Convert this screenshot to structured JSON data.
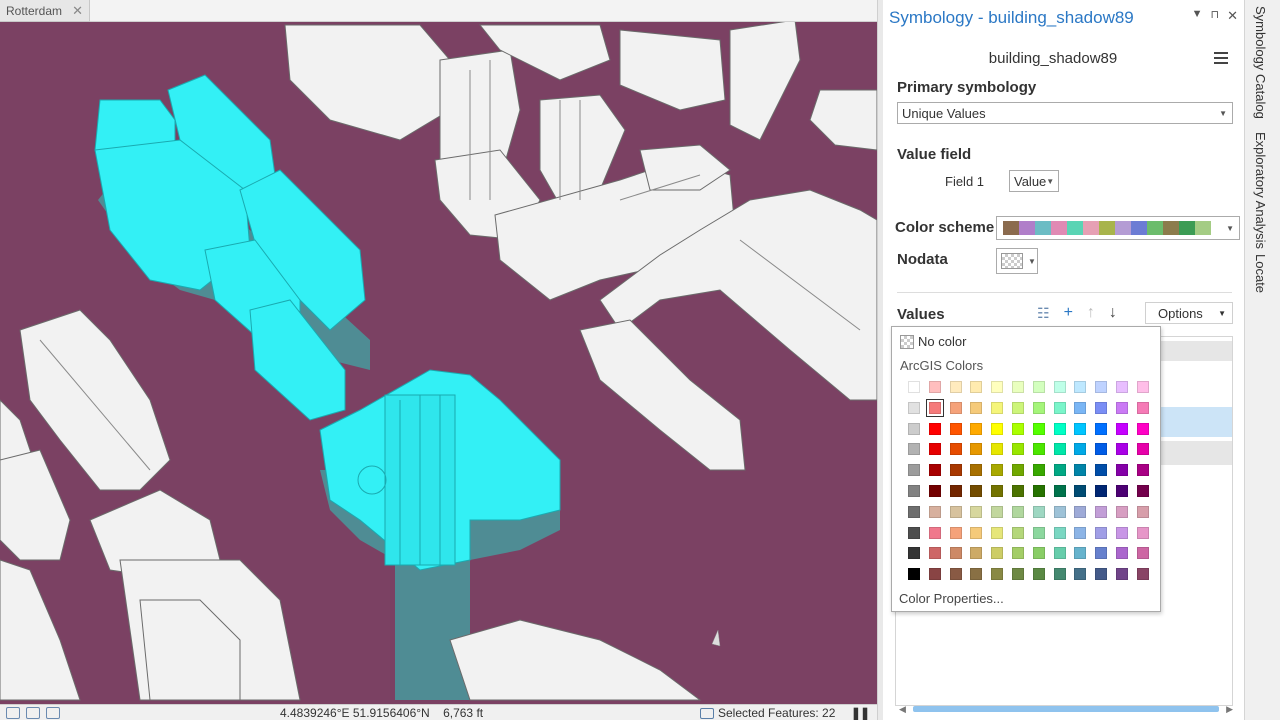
{
  "map": {
    "tab_label": "Rotterdam",
    "tab_close": "✕",
    "status": {
      "coordinates": "4.4839246°E 51.9156406°N",
      "scale": "6,763 ft",
      "selected_features": "Selected Features: 22"
    }
  },
  "pane": {
    "title": "Symbology - building_shadow89",
    "layer_name": "building_shadow89",
    "primary_symbology_label": "Primary symbology",
    "primary_symbology_value": "Unique Values",
    "value_field_label": "Value field",
    "field1_label": "Field 1",
    "field1_value": "Value",
    "color_scheme_label": "Color scheme",
    "color_scheme_colors": [
      "#8b6b4e",
      "#b07ec9",
      "#6cbcc4",
      "#e08ab4",
      "#5ad4b4",
      "#e6a0b4",
      "#a8b44c",
      "#b49cd4",
      "#6c7cd4",
      "#6cbc6c",
      "#8c7c4c",
      "#3c9c54",
      "#a4cc84"
    ],
    "nodata_label": "Nodata",
    "values_label": "Values",
    "options_label": "Options"
  },
  "color_popup": {
    "no_color_label": "No color",
    "section_label": "ArcGIS Colors",
    "color_properties_label": "Color Properties...",
    "selected": {
      "row": 1,
      "col": 1
    },
    "rows": [
      [
        "#ffffff",
        "#ffbebe",
        "#ffebbe",
        "#ffebaf",
        "#ffffbe",
        "#e9ffbe",
        "#d3ffbe",
        "#beffe8",
        "#bee8ff",
        "#bed2ff",
        "#e8beff",
        "#ffbee8"
      ],
      [
        "#e1e1e1",
        "#f57a7a",
        "#f5a27a",
        "#f5ca7a",
        "#f5f57a",
        "#cdf57a",
        "#a5f57a",
        "#7af5ca",
        "#7ab6f5",
        "#7a8ef5",
        "#ca7af5",
        "#f57ab6"
      ],
      [
        "#cccccc",
        "#ff0000",
        "#ff5500",
        "#ffaa00",
        "#ffff00",
        "#aaff00",
        "#55ff00",
        "#00ffc5",
        "#00c5ff",
        "#0070ff",
        "#c500ff",
        "#ff00c5"
      ],
      [
        "#b2b2b2",
        "#e60000",
        "#e64c00",
        "#e69800",
        "#e6e600",
        "#98e600",
        "#4ce600",
        "#00e6a9",
        "#00a9e6",
        "#005ce6",
        "#a900e6",
        "#e600a9"
      ],
      [
        "#9c9c9c",
        "#a80000",
        "#a83800",
        "#a87000",
        "#a8a800",
        "#70a800",
        "#38a800",
        "#00a884",
        "#0084a8",
        "#004da8",
        "#8400a8",
        "#a80084"
      ],
      [
        "#828282",
        "#730000",
        "#732600",
        "#734c00",
        "#737300",
        "#4c7300",
        "#267300",
        "#00734c",
        "#004c73",
        "#002673",
        "#4c0073",
        "#73004c"
      ],
      [
        "#6e6e6e",
        "#d7b09e",
        "#d7c29e",
        "#d7d79e",
        "#c2d79e",
        "#b0d79e",
        "#9ed7c2",
        "#9ec2d7",
        "#9eaad7",
        "#c29ed7",
        "#d79ec2",
        "#d79eaa"
      ],
      [
        "#4e4e4e",
        "#f0788c",
        "#f5a27a",
        "#f5ca7a",
        "#e6e67a",
        "#b4d77a",
        "#8cd79e",
        "#7ad7c2",
        "#8cb4e6",
        "#a09ee6",
        "#c896e6",
        "#e696c8"
      ],
      [
        "#343434",
        "#cd6666",
        "#cd8966",
        "#cdaa66",
        "#cdcd66",
        "#a3cd66",
        "#89cd66",
        "#66cdab",
        "#66b3cd",
        "#6680cd",
        "#aa66cd",
        "#cd66a3"
      ],
      [
        "#000000",
        "#894444",
        "#895a44",
        "#897044",
        "#898944",
        "#6e8944",
        "#5a8944",
        "#448970",
        "#447089",
        "#445a89",
        "#704489",
        "#894465"
      ]
    ]
  },
  "sidetabs": [
    "Symbology",
    "Catalog",
    "Exploratory Analysis",
    "Locate"
  ]
}
